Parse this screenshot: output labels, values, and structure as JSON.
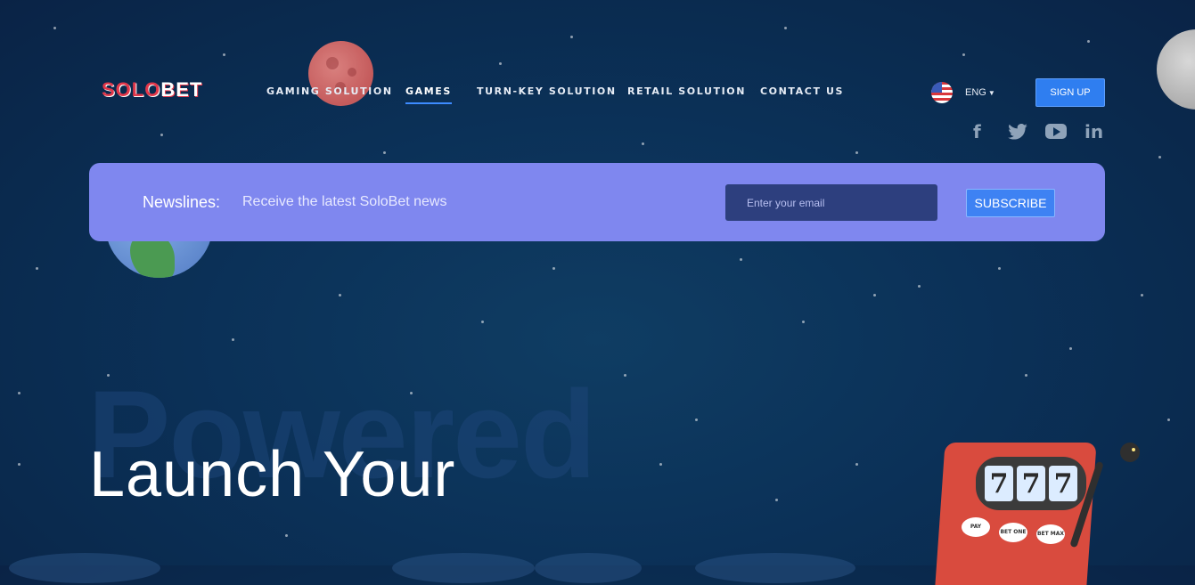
{
  "brand": {
    "logo_part1": "SOLO",
    "logo_part2": "BET"
  },
  "nav": {
    "items": [
      {
        "label": "GAMING SOLUTION",
        "active": false
      },
      {
        "label": "GAMES",
        "active": true
      },
      {
        "label": "TURN-KEY SOLUTION",
        "active": false
      },
      {
        "label": "RETAIL SOLUTION",
        "active": false
      },
      {
        "label": "CONTACT US",
        "active": false
      }
    ]
  },
  "language": {
    "current": "ENG",
    "flag_icon": "us-flag-icon"
  },
  "header": {
    "signup_label": "SIGN UP"
  },
  "social": {
    "icons": [
      "facebook-icon",
      "twitter-icon",
      "youtube-icon",
      "linkedin-icon"
    ],
    "facebook_glyph": "f",
    "linkedin_glyph": "in"
  },
  "newsletter": {
    "title": "Newslines:",
    "subtitle": "Receive the latest SoloBet news",
    "email_placeholder": "Enter your email",
    "subscribe_label": "SUBSCRIBE"
  },
  "hero": {
    "background_word": "Powered",
    "headline": "Launch Your"
  },
  "slot_machine": {
    "reels": [
      "7",
      "7",
      "7"
    ],
    "buttons": [
      "PAY",
      "BET ONE",
      "BET MAX"
    ]
  },
  "colors": {
    "accent": "#2f7ef0",
    "newsletter_bg": "#7f87ef",
    "logo_red": "#e2374a",
    "background": "#0b3158"
  }
}
